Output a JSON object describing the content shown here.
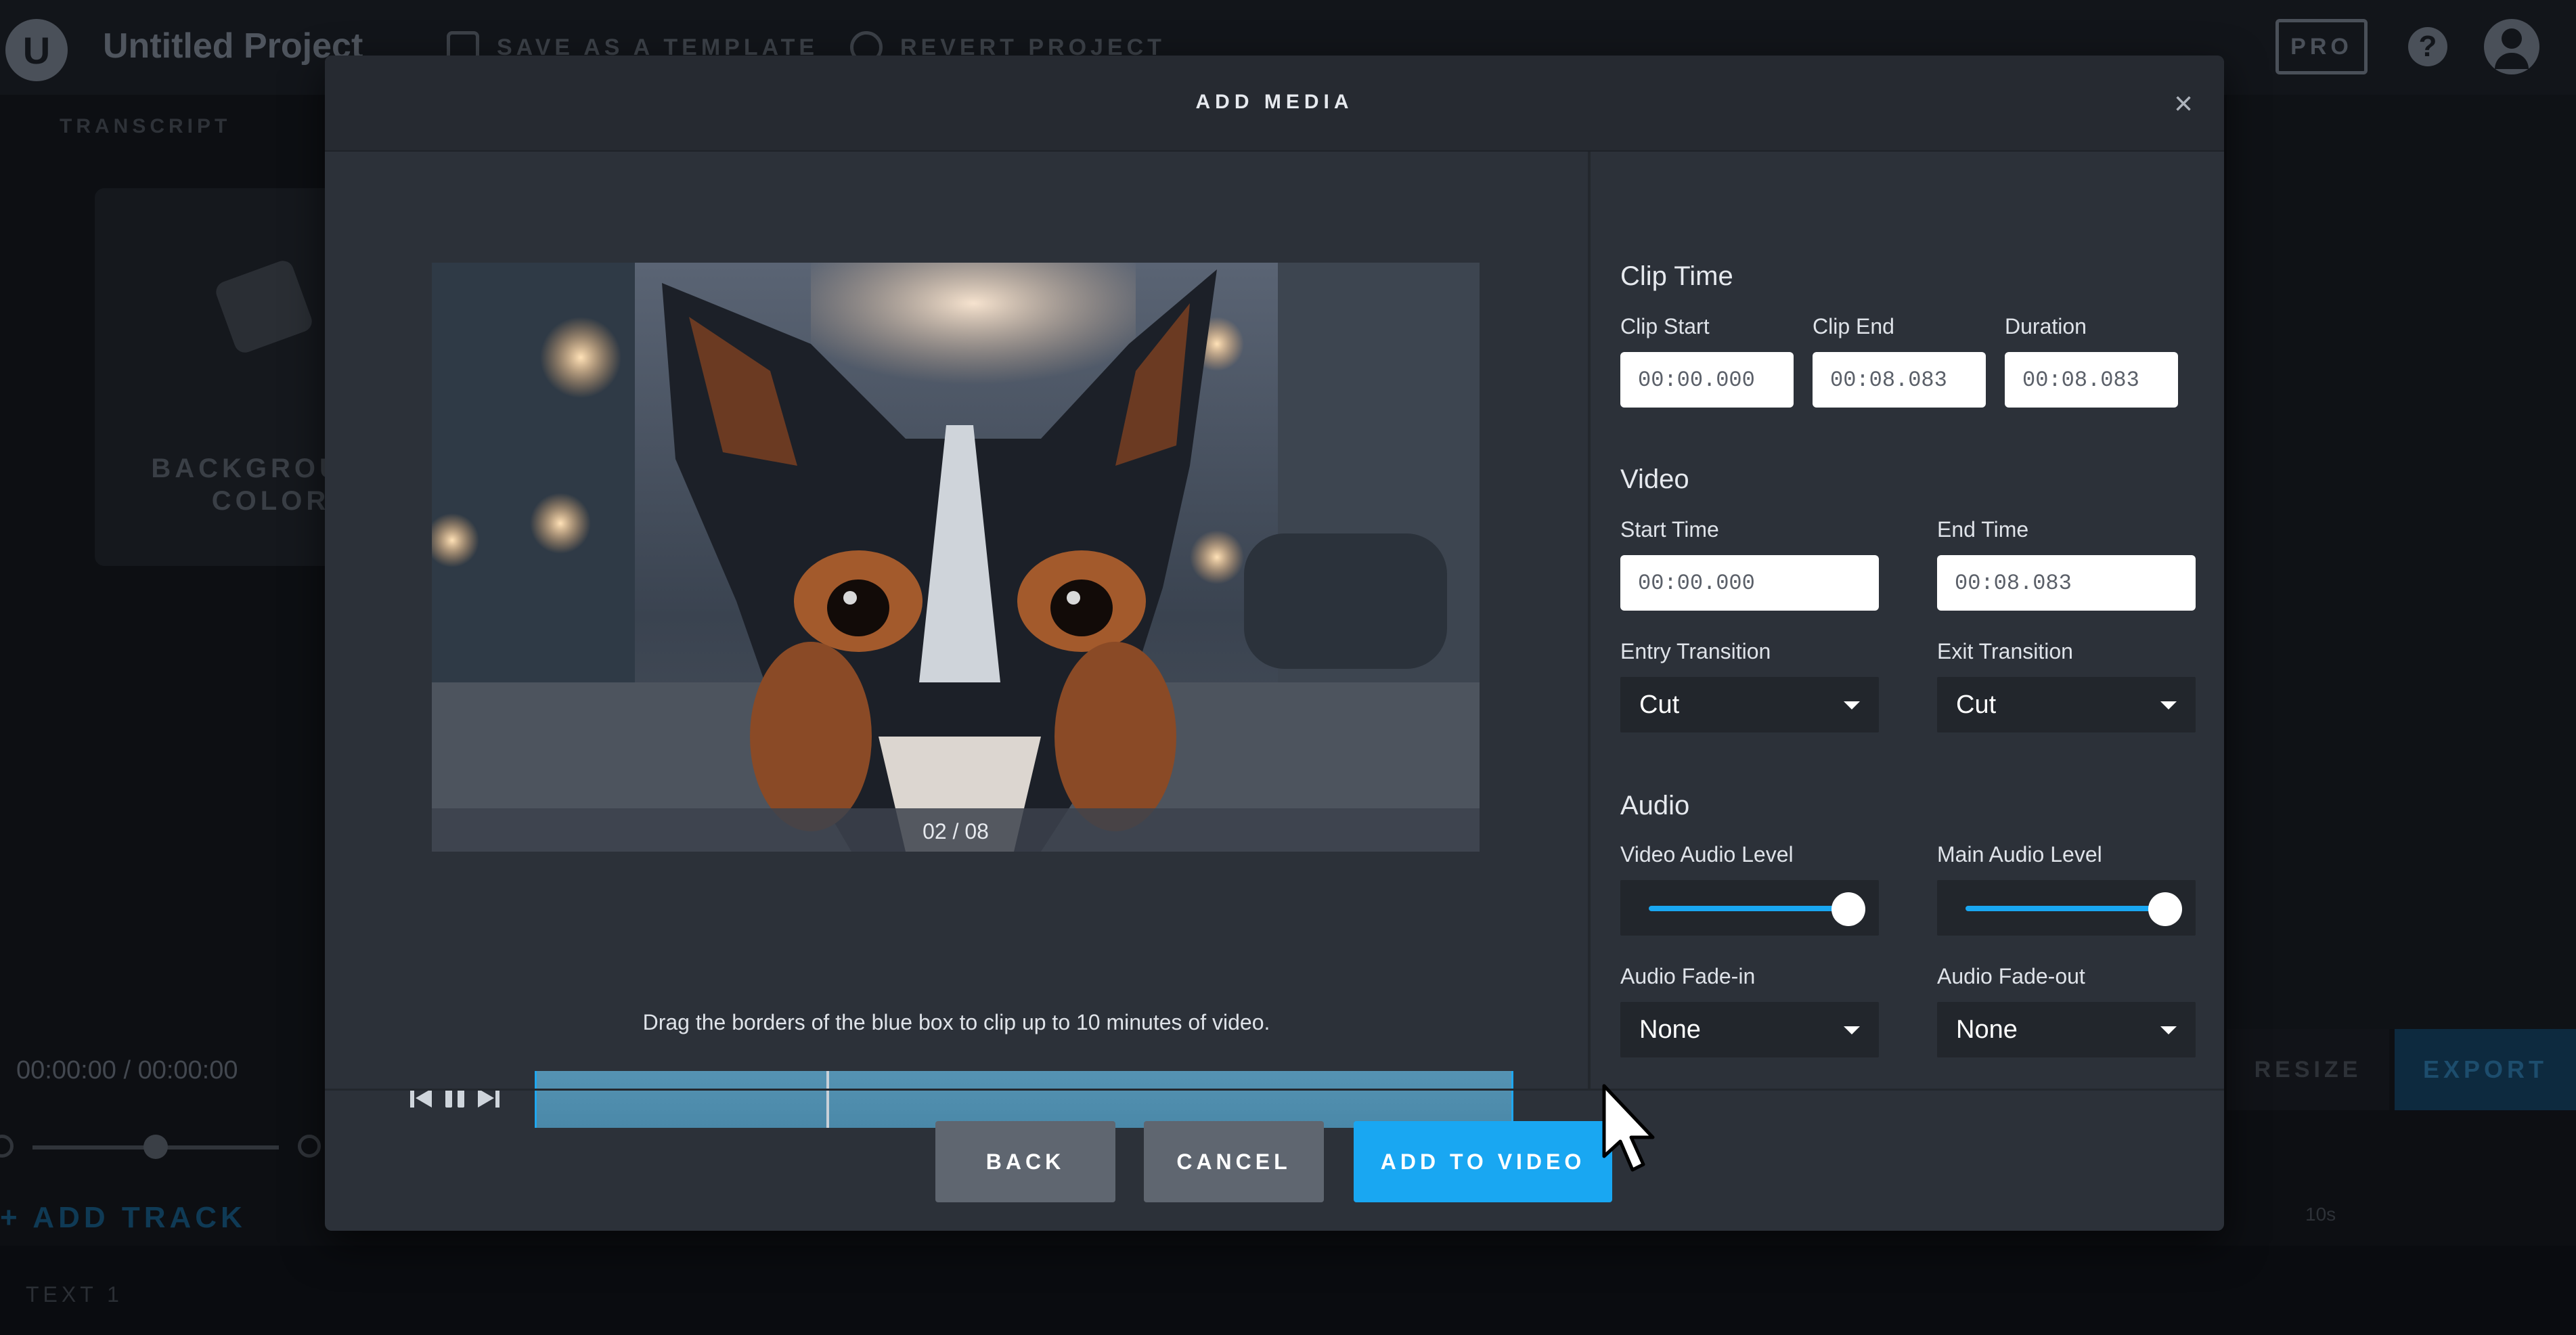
{
  "app": {
    "project_title": "Untitled Project",
    "save_template": "SAVE AS A TEMPLATE",
    "revert_project": "REVERT PROJECT",
    "pro_badge": "PRO",
    "transcript_tab": "TRANSCRIPT",
    "background_color_label": "BACKGROUND COLOR",
    "timecode": "00:00:00 / 00:00:00",
    "add_track": "+ ADD TRACK",
    "track_label": "TEXT 1",
    "timeline_tick": "10s",
    "resize_label": "RESIZE",
    "export_label": "EXPORT"
  },
  "modal": {
    "title": "ADD MEDIA",
    "close": "×",
    "preview": {
      "page_indicator": "02 / 08"
    },
    "hint": "Drag the borders of the blue box to clip up to 10 minutes of video.",
    "clip_time": {
      "title": "Clip Time",
      "clip_start_label": "Clip Start",
      "clip_start": "00:00.000",
      "clip_end_label": "Clip End",
      "clip_end": "00:08.083",
      "duration_label": "Duration",
      "duration": "00:08.083"
    },
    "video": {
      "title": "Video",
      "start_time_label": "Start Time",
      "start_time": "00:00.000",
      "end_time_label": "End Time",
      "end_time": "00:08.083",
      "entry_transition_label": "Entry Transition",
      "entry_transition": "Cut",
      "exit_transition_label": "Exit Transition",
      "exit_transition": "Cut"
    },
    "audio": {
      "title": "Audio",
      "video_audio_level_label": "Video Audio Level",
      "main_audio_level_label": "Main Audio Level",
      "video_audio_level": 1.0,
      "main_audio_level": 1.0,
      "fade_in_label": "Audio Fade-in",
      "fade_in": "None",
      "fade_out_label": "Audio Fade-out",
      "fade_out": "None"
    },
    "buttons": {
      "back": "BACK",
      "cancel": "CANCEL",
      "add_to_video": "ADD TO VIDEO"
    }
  },
  "colors": {
    "accent": "#19a7f2",
    "modal_bg": "#2c3139",
    "header_bg": "#262a31"
  }
}
